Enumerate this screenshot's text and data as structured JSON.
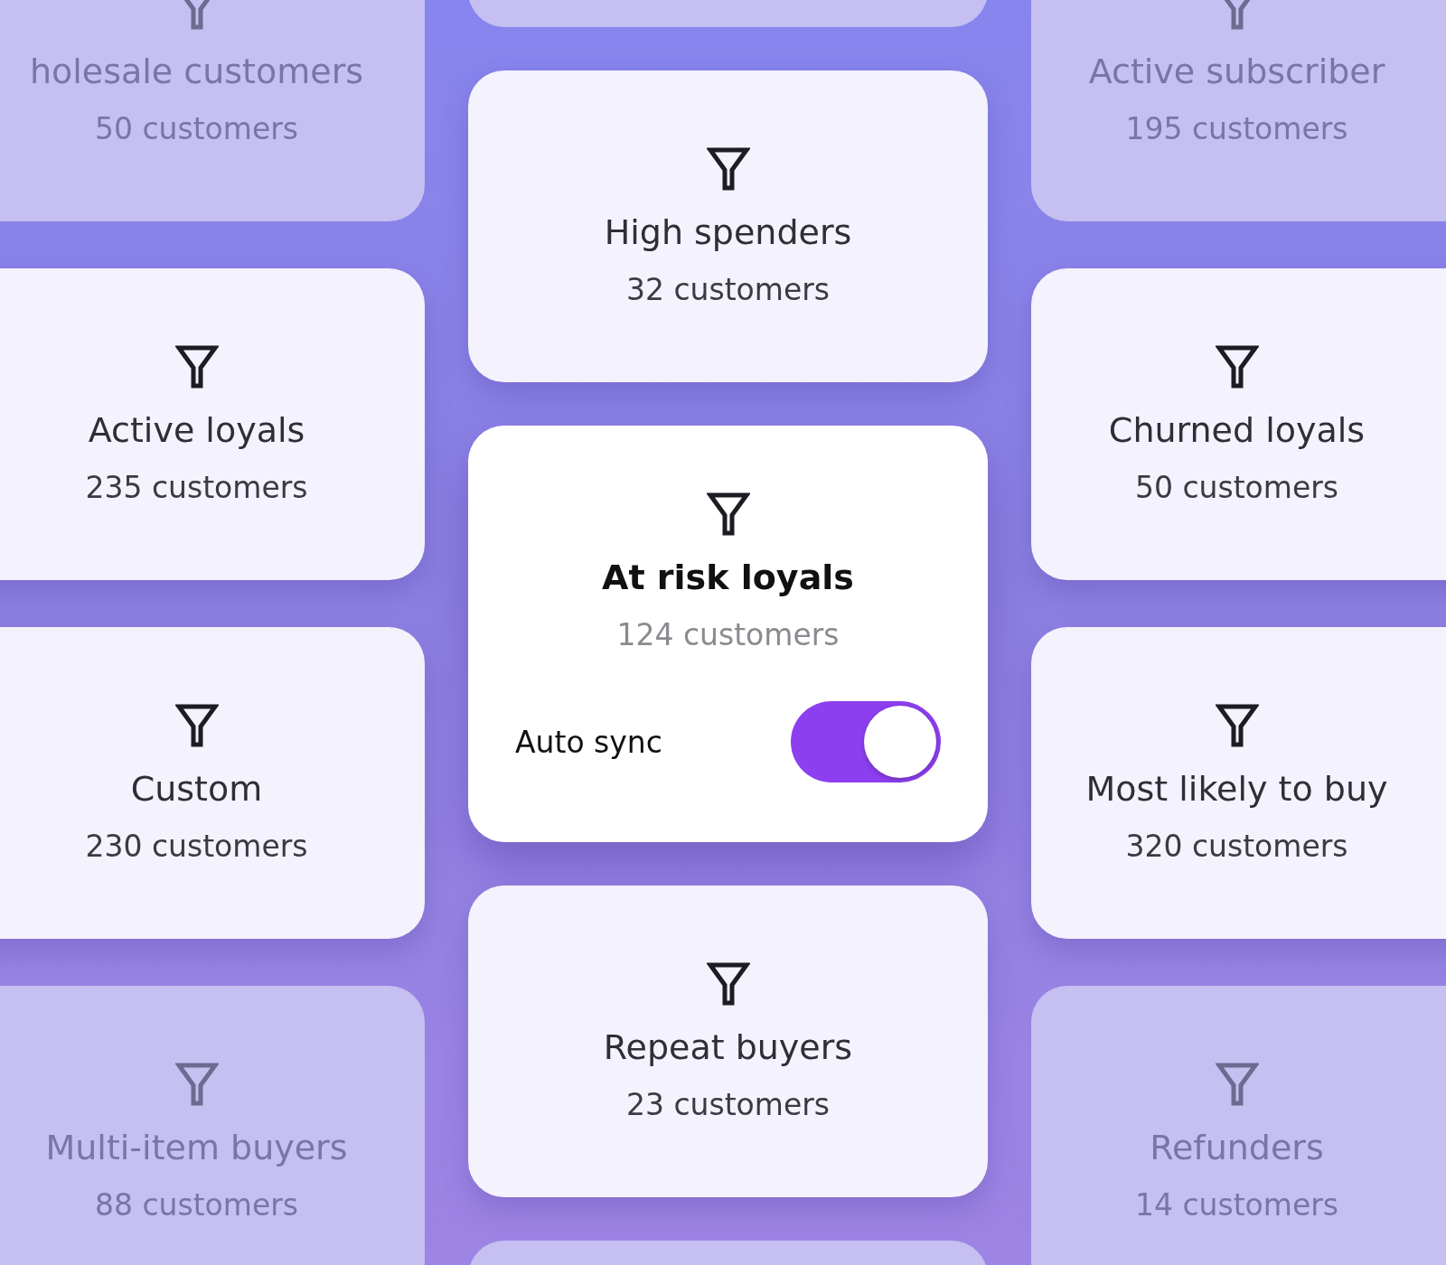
{
  "columns": [
    {
      "cards": [
        {
          "kind": "segment",
          "title": "holesale customers",
          "count": "50 customers",
          "dimmed": true
        },
        {
          "kind": "segment",
          "title": "Active loyals",
          "count": "235 customers",
          "dimmed": false
        },
        {
          "kind": "segment",
          "title": "Custom",
          "count": "230 customers",
          "dimmed": false
        },
        {
          "kind": "segment",
          "title": "Multi-item buyers",
          "count": "88 customers",
          "dimmed": true
        }
      ]
    },
    {
      "cards": [
        {
          "kind": "blank",
          "dimmed": true
        },
        {
          "kind": "segment",
          "title": "High spenders",
          "count": "32 customers",
          "dimmed": false
        },
        {
          "kind": "featured",
          "title": "At risk loyals",
          "count": "124 customers",
          "dimmed": false,
          "toggle": {
            "label": "Auto sync",
            "on": true
          }
        },
        {
          "kind": "segment",
          "title": "Repeat buyers",
          "count": "23 customers",
          "dimmed": false
        },
        {
          "kind": "blank",
          "dimmed": true
        }
      ]
    },
    {
      "cards": [
        {
          "kind": "segment",
          "title": "Active subscriber",
          "count": "195 customers",
          "dimmed": true
        },
        {
          "kind": "segment",
          "title": "Churned loyals",
          "count": "50 customers",
          "dimmed": false
        },
        {
          "kind": "segment",
          "title": "Most likely to buy",
          "count": "320 customers",
          "dimmed": false
        },
        {
          "kind": "segment",
          "title": "Refunders",
          "count": "14 customers",
          "dimmed": true
        }
      ]
    }
  ]
}
